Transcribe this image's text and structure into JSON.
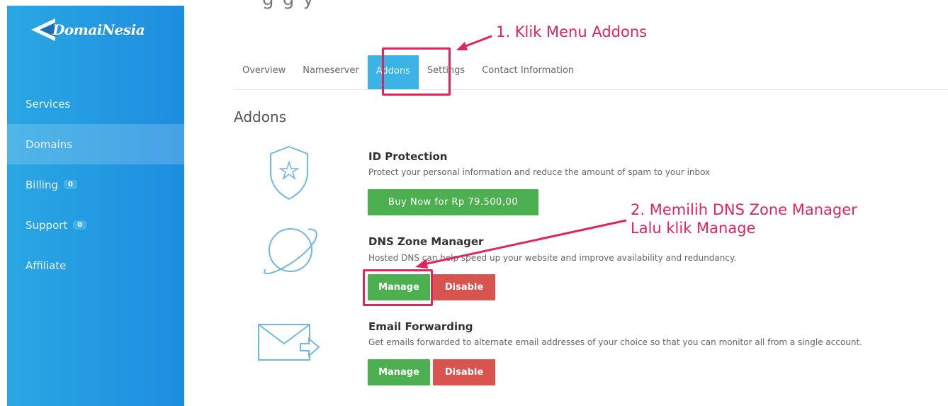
{
  "brand": {
    "logo_text": "DomaiNesia"
  },
  "header": {
    "partial_title": "g   g        y"
  },
  "sidebar": {
    "items": [
      {
        "label": "Services"
      },
      {
        "label": "Domains",
        "active": true
      },
      {
        "label": "Billing",
        "badge": "0"
      },
      {
        "label": "Support",
        "badge": "0"
      },
      {
        "label": "Affiliate"
      }
    ]
  },
  "tabs": [
    {
      "label": "Overview"
    },
    {
      "label": "Nameserver"
    },
    {
      "label": "Addons",
      "active": true
    },
    {
      "label": "Settings"
    },
    {
      "label": "Contact Information"
    }
  ],
  "section": {
    "title": "Addons"
  },
  "addons": [
    {
      "title": "ID Protection",
      "description": "Protect your personal information and reduce the amount of spam to your inbox",
      "buy_label": "Buy Now for Rp 79.500,00",
      "icon": "shield-star-icon"
    },
    {
      "title": "DNS Zone Manager",
      "description": "Hosted DNS can help speed up your website and improve availability and redundancy.",
      "manage_label": "Manage",
      "disable_label": "Disable",
      "icon": "planet-icon"
    },
    {
      "title": "Email Forwarding",
      "description": "Get emails forwarded to alternate email addresses of your choice so that you can monitor all from a single account.",
      "manage_label": "Manage",
      "disable_label": "Disable",
      "icon": "envelope-forward-icon"
    }
  ],
  "annotations": {
    "step1": "1. Klik Menu Addons",
    "step2_line1": "2. Memilih DNS Zone Manager",
    "step2_line2": "Lalu klik Manage"
  },
  "colors": {
    "accent": "#3bb4e5",
    "annotation": "#e0245e",
    "green": "#4caf50",
    "red": "#d9534f"
  }
}
